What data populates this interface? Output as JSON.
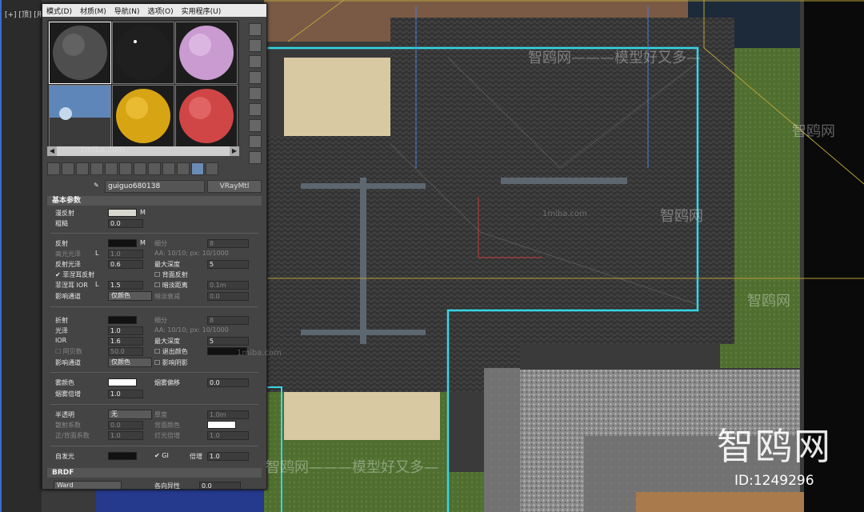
{
  "viewport": {
    "label": "[+] [顶] [用户定义] [真实]"
  },
  "colors": {
    "accent_cyan": "#35d6e6",
    "guide_yellow": "#b8a23a",
    "roof_dark": "#353535",
    "grass": "#4f6e30"
  },
  "material_editor": {
    "menu": [
      "模式(D)",
      "材质(M)",
      "导航(N)",
      "选项(O)",
      "实用程序(U)"
    ],
    "material_name": "guiguo680138",
    "material_type": "VRayMtl",
    "rollout_basic": "基本参数",
    "rollout_brdf": "BRDF",
    "diffuse": {
      "label": "漫反射",
      "m": "M"
    },
    "roughness": {
      "label": "粗糙",
      "value": "0.0"
    },
    "reflect": {
      "label": "反射",
      "m": "M",
      "subdivs_label": "细分",
      "subdivs": "8"
    },
    "hilight_gloss": {
      "label": "高光光泽",
      "l": "L",
      "value": "1.0",
      "aa": "AA: 10/10; px: 10/1000"
    },
    "refl_gloss": {
      "label": "反射光泽",
      "value": "0.6",
      "max_depth_label": "最大深度",
      "max_depth": "5"
    },
    "fresnel": {
      "label": "菲涅耳反射",
      "back_reflect": "背面反射"
    },
    "fresnel_ior": {
      "label": "菲涅耳 IOR",
      "l": "L",
      "value": "1.5",
      "dim_distance": "暗淡距离",
      "dim_value": "0.1m"
    },
    "affect_channels": {
      "label": "影响通道",
      "value": "仅颜色",
      "dim_falloff": "暗淡衰减",
      "dim_falloff_value": "0.0"
    },
    "refract": {
      "label": "折射",
      "subdivs_label": "细分",
      "subdivs": "8"
    },
    "glossiness": {
      "label": "光泽",
      "value": "1.0",
      "aa": "AA: 10/10; px: 10/1000"
    },
    "ior": {
      "label": "IOR",
      "value": "1.6",
      "max_depth_label": "最大深度",
      "max_depth": "5"
    },
    "abbe": {
      "label": "阿贝数",
      "value": "50.0",
      "exit_color": "退出颜色"
    },
    "refr_affect": {
      "label": "影响通道",
      "value": "仅颜色",
      "affect_shadows": "影响阴影"
    },
    "fog_color": {
      "label": "雾颜色",
      "bias_label": "烟雾偏移",
      "bias": "0.0"
    },
    "fog_mult": {
      "label": "烟雾倍增",
      "value": "1.0"
    },
    "translucency": {
      "label": "半透明",
      "value": "无",
      "thickness_label": "厚度",
      "thickness": "1.0m"
    },
    "scatter": {
      "label": "散射系数",
      "value": "0.0",
      "back_color": "背面颜色"
    },
    "fb": {
      "label": "正/背面系数",
      "value": "1.0",
      "light_mult": "灯光倍增",
      "light_mult_value": "1.0"
    },
    "self_illum": {
      "label": "自发光",
      "gi": "GI",
      "mult_label": "倍增",
      "mult": "1.0"
    },
    "brdf": {
      "type": "Ward",
      "aniso": "各向异性",
      "aniso_value": "0.0"
    }
  },
  "watermarks": {
    "logo": "智鸥网",
    "id": "ID:1249296",
    "slogan": "智鸥网———模型好又多—",
    "slogan_mid": "智鸥网",
    "site": "1miba.com"
  }
}
